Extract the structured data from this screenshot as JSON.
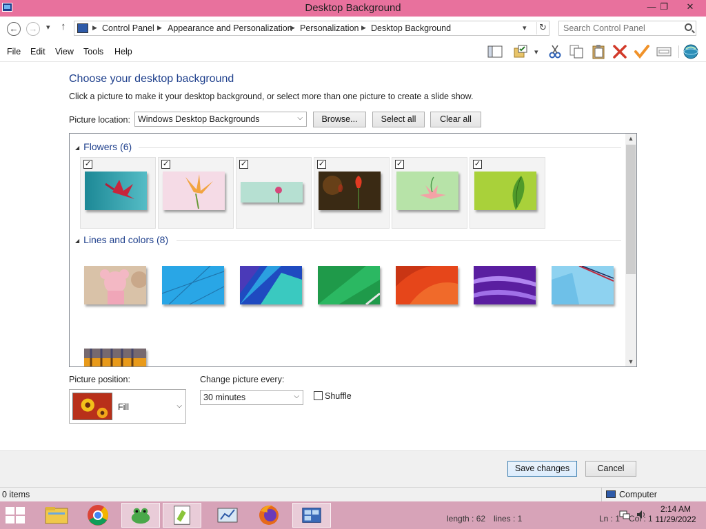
{
  "window": {
    "title": "Desktop Background",
    "minimize_glyph": "—",
    "maximize_glyph": "❐",
    "close_glyph": "✕"
  },
  "address": {
    "back_glyph": "←",
    "forward_glyph": "→",
    "dropdown_glyph": "▾",
    "up_glyph": "↑",
    "separator_glyph": "▶",
    "refresh_glyph": "↻",
    "crumbs": [
      "Control Panel",
      "Appearance and Personalization",
      "Personalization",
      "Desktop Background"
    ],
    "search_placeholder": "Search Control Panel"
  },
  "menu": [
    "File",
    "Edit",
    "View",
    "Tools",
    "Help"
  ],
  "toolbar_icons": [
    "layout-icon",
    "folder-check-icon",
    "scissors-icon",
    "copy-icon",
    "paste-icon",
    "delete-icon",
    "check-icon",
    "properties-icon",
    "globe-icon"
  ],
  "content": {
    "heading": "Choose your desktop background",
    "subtext": "Click a picture to make it your desktop background, or select more than one picture to create a slide show.",
    "picture_location_label": "Picture location:",
    "picture_location_value": "Windows Desktop Backgrounds",
    "browse": "Browse...",
    "select_all": "Select all",
    "clear_all": "Clear all"
  },
  "gallery": {
    "checkmark": "✓",
    "collapse_glyph": "◢",
    "groups": [
      {
        "title": "Flowers (6)",
        "count": 6,
        "selected": true
      },
      {
        "title": "Lines and colors (8)",
        "count": 8,
        "selected": false
      }
    ]
  },
  "position": {
    "label": "Picture position:",
    "value": "Fill",
    "change_label": "Change picture every:",
    "change_value": "30 minutes",
    "shuffle": "Shuffle"
  },
  "footer": {
    "save": "Save changes",
    "cancel": "Cancel"
  },
  "status": {
    "items": "0 items",
    "computer": "Computer"
  },
  "taskbar": {
    "text_length": "length : 62",
    "text_lines": "lines : 1",
    "text_ln": "Ln : 1",
    "text_col": "Col : 1",
    "time": "2:14 AM",
    "date": "11/29/2022"
  },
  "colors": {
    "title_bar": "#e8719d",
    "heading": "#1e3f8c",
    "taskbar": "#d7a3b8"
  }
}
